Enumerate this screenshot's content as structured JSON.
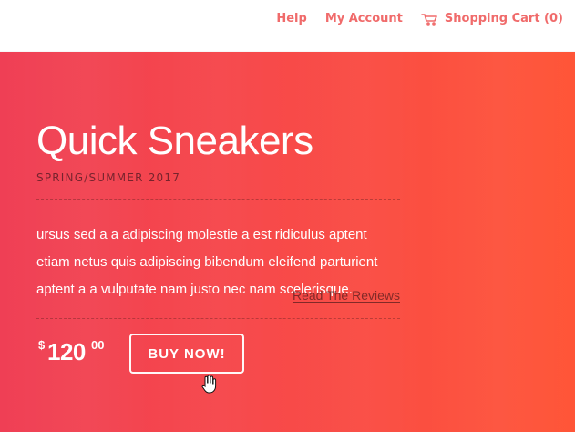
{
  "header": {
    "nav": [
      {
        "label": "Help"
      },
      {
        "label": "My Account"
      },
      {
        "label": "Shopping Cart (0)",
        "icon": "cart-icon"
      }
    ]
  },
  "hero": {
    "title": "Quick Sneakers",
    "subtitle": "SPRING/SUMMER 2017",
    "description": "ursus sed a a adipiscing molestie a est ridiculus aptent etiam netus quis adipiscing bibendum eleifend parturient aptent a a vulputate nam justo nec nam scelerisque.",
    "reviews_link": "Read The Reviews",
    "price": {
      "currency": "$",
      "amount": "120",
      "cents": "00"
    },
    "buy_button": "BUY NOW!"
  },
  "colors": {
    "accent": "#f06b6b",
    "hero_start": "#ef3f55",
    "hero_end": "#ff5537",
    "text_light": "#ffffff"
  },
  "icons": {
    "cart": "cart-icon",
    "pointer": "hand-cursor-icon"
  }
}
